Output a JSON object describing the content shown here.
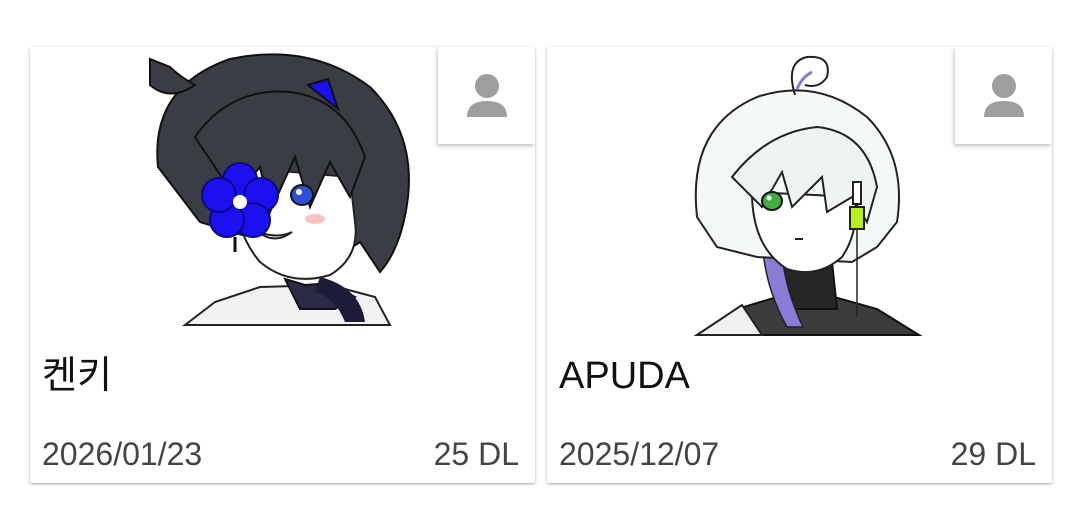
{
  "cards": [
    {
      "name": "켄키",
      "date": "2026/01/23",
      "downloads": "25 DL",
      "art_icon": "character-portrait-dark-hair-blue-flower",
      "avatar_icon": "person-icon"
    },
    {
      "name": "APUDA",
      "date": "2025/12/07",
      "downloads": "29 DL",
      "art_icon": "character-portrait-white-hair-eyepatch",
      "avatar_icon": "person-icon"
    }
  ],
  "colors": {
    "card_bg": "#ffffff",
    "text_primary": "#111111",
    "text_secondary": "#444444",
    "icon_gray": "#9e9e9e",
    "flower_blue": "#1a10f0"
  }
}
